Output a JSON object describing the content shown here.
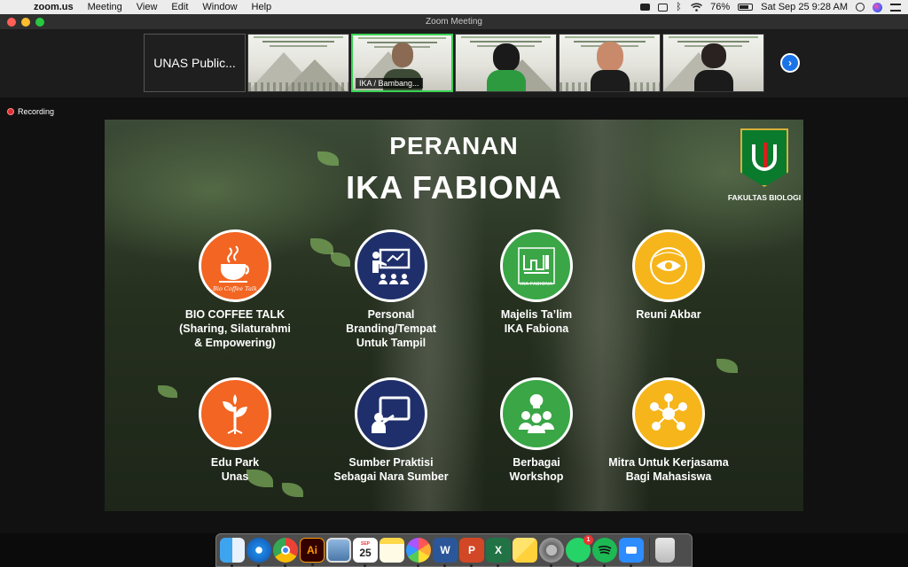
{
  "menubar": {
    "app_name": "zoom.us",
    "menus": [
      "Meeting",
      "View",
      "Edit",
      "Window",
      "Help"
    ],
    "battery_percent": "76%",
    "battery_level": 0.76,
    "datetime": "Sat Sep 25  9:28 AM"
  },
  "window": {
    "title": "Zoom Meeting"
  },
  "filmstrip": {
    "first_tile_name": "UNAS Public...",
    "active_tile_label": "IKA / Bambang...",
    "next_button_icon": "chevron-right-icon"
  },
  "recording_label": "Recording",
  "slide": {
    "title_line1": "PERANAN",
    "title_line2": "IKA FABIONA",
    "logo_label": "FAKULTAS BIOLOGI",
    "items": [
      {
        "label": "BIO COFFEE TALK\n(Sharing, Silaturahmi\n& Empowering)",
        "color": "#f26522",
        "icon": "coffee-cup-icon",
        "caption": "Bio Coffee Talk"
      },
      {
        "label": "Personal\nBranding/Tempat\nUntuk Tampil",
        "color": "#1e2f6b",
        "icon": "presenter-icon"
      },
      {
        "label": "Majelis Ta’lim\nIKA Fabiona",
        "color": "#3aa646",
        "icon": "majelis-logo-icon",
        "caption": "IKA FABIONA"
      },
      {
        "label": "Reuni Akbar",
        "color": "#f6b51b",
        "icon": "reunion-logo-icon"
      },
      {
        "label": "Edu Park\nUnas",
        "color": "#f26522",
        "icon": "plant-icon"
      },
      {
        "label": "Sumber Praktisi\nSebagai Nara Sumber",
        "color": "#1e2f6b",
        "icon": "teaching-icon"
      },
      {
        "label": "Berbagai\nWorkshop",
        "color": "#3aa646",
        "icon": "workshop-icon"
      },
      {
        "label": "Mitra Untuk Kerjasama\nBagi Mahasiswa",
        "color": "#f6b51b",
        "icon": "network-icon"
      }
    ]
  },
  "dock": {
    "apps": [
      "Finder",
      "Safari",
      "Chrome",
      "Ai",
      "Preview",
      "Calendar",
      "Notes",
      "Photos",
      "W",
      "P",
      "X",
      "Stickies",
      "System Preferences",
      "WhatsApp",
      "Spotify",
      "Zoom",
      "Trash"
    ],
    "calendar_month": "SEP",
    "calendar_day": "25",
    "whatsapp_badge": "1"
  }
}
